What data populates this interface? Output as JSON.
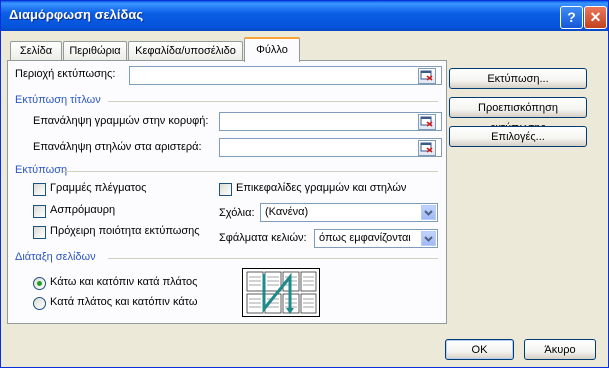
{
  "window": {
    "title": "Διαμόρφωση σελίδας",
    "help_glyph": "?",
    "close_glyph": "✕"
  },
  "tabs": [
    {
      "label": "Σελίδα"
    },
    {
      "label": "Περιθώρια"
    },
    {
      "label": "Κεφαλίδα/υποσέλιδο"
    },
    {
      "label": "Φύλλο",
      "active": true
    }
  ],
  "print_area": {
    "label": "Περιοχή εκτύπωσης:",
    "value": ""
  },
  "print_titles": {
    "section": "Εκτύπωση τίτλων",
    "rows_label": "Επανάληψη γραμμών στην κορυφή:",
    "rows_value": "",
    "cols_label": "Επανάληψη στηλών στα αριστερά:",
    "cols_value": ""
  },
  "print": {
    "section": "Εκτύπωση",
    "gridlines": {
      "label": "Γραμμές πλέγματος",
      "checked": false
    },
    "black_white": {
      "label": "Ασπρόμαυρη",
      "checked": false
    },
    "draft": {
      "label": "Πρόχειρη ποιότητα εκτύπωσης",
      "checked": false
    },
    "headings": {
      "label": "Επικεφαλίδες γραμμών και στηλών",
      "checked": false
    },
    "comments_label": "Σχόλια:",
    "comments_value": "(Κανένα)",
    "errors_label": "Σφάλματα κελιών:",
    "errors_value": "όπως εμφανίζονται"
  },
  "page_order": {
    "section": "Διάταξη σελίδων",
    "down_then_over": {
      "label": "Κάτω και κατόπιν κατά πλάτος",
      "selected": true
    },
    "over_then_down": {
      "label": "Κατά πλάτος και κατόπιν κάτω",
      "selected": false
    }
  },
  "side_buttons": {
    "print": "Εκτύπωση...",
    "preview": "Προεπισκόπηση εκτύπωσης",
    "options": "Επιλογές..."
  },
  "footer": {
    "ok": "OK",
    "cancel": "Άκυρο"
  },
  "colors": {
    "accent": "#2B56C4",
    "titlebar": "#0A5FE6",
    "dialog_bg": "#ECE9D8"
  },
  "icons": {
    "collapse": "collapse-dialog-icon",
    "dropdown": "chevron-down-icon",
    "preview": "page-order-preview-icon"
  }
}
